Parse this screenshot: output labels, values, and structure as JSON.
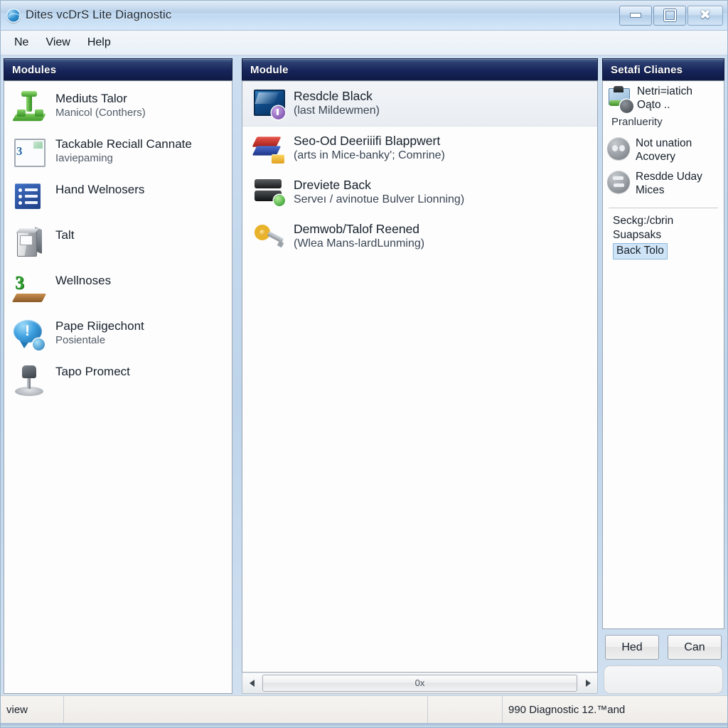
{
  "window": {
    "title": "Dites vcDrS Lite Diagnostic",
    "app_icon": "globe-icon",
    "controls": {
      "minimize": "minimize-icon",
      "maximize": "maximize-icon",
      "close": "close-icon"
    }
  },
  "menubar": {
    "items": [
      "Ne",
      "View",
      "Help"
    ]
  },
  "panels": {
    "left": {
      "header": "Modules",
      "items": [
        {
          "icon": "green-plug-icon",
          "title": "Mediuts Talor",
          "subtitle": "Manicol (Conthers)"
        },
        {
          "icon": "framed-photo-icon",
          "title": "Tackable Reciall Cannate",
          "subtitle": "Iaviepaming"
        },
        {
          "icon": "blue-list-icon",
          "title": "Hand Welnosers",
          "subtitle": ""
        },
        {
          "icon": "pc-tower-icon",
          "title": "Talt",
          "subtitle": ""
        },
        {
          "icon": "wood-board-icon",
          "title": "Wellnoses",
          "subtitle": ""
        },
        {
          "icon": "blue-bubble-icon",
          "title": "Pape Riigechont",
          "subtitle": "Posientale"
        },
        {
          "icon": "microphone-icon",
          "title": "Tapo Promect",
          "subtitle": ""
        }
      ]
    },
    "middle": {
      "header": "Module",
      "items": [
        {
          "icon": "blue-screen-icon",
          "title": "Resdcle Black",
          "subtitle": "(last Mildewmen)",
          "selected": true
        },
        {
          "icon": "red-boxes-icon",
          "title": "Seo-Od Deeriiifi Blappwert",
          "subtitle": "(arts in Mice-banky'; Comrine)",
          "selected": false
        },
        {
          "icon": "black-server-icon",
          "title": "Dreviete Back",
          "subtitle": "Serveı / avinotue Bulver Lionning)",
          "selected": false
        },
        {
          "icon": "gold-key-icon",
          "title": "Demwob/Talof Reened",
          "subtitle": "(Wlea Mans-lardLunming)",
          "selected": false
        }
      ],
      "scrollbar": {
        "left_arrow": "triangle-left-icon",
        "right_arrow": "triangle-right-icon",
        "thumb_label": "0x"
      }
    },
    "right": {
      "header": "Setafi Clianes",
      "rows": [
        {
          "icon": "camera-tool-icon",
          "title": "Netri=iatich",
          "line2": "Oąto ..",
          "sub": "Pranluerity"
        },
        {
          "icon": "gray-round-icon",
          "title": "Not unation",
          "line2": "Acovery",
          "sub": ""
        },
        {
          "icon": "gray-round-alt-icon",
          "title": "Resdde Uday",
          "line2": "Mices",
          "sub": ""
        }
      ],
      "links": [
        {
          "label": "Seckg:/cbrin",
          "selected": false
        },
        {
          "label": "Suapsaks",
          "selected": false
        },
        {
          "label": "Back Tolo",
          "selected": true
        }
      ],
      "buttons": [
        "Hed",
        "Can"
      ]
    }
  },
  "statusbar": {
    "left": "view",
    "middle": "",
    "third": "",
    "right": "990 Diagnostic 12.™and"
  },
  "colors": {
    "panel_header_start": "#4a6392",
    "panel_header_end": "#101a44",
    "selection_blue": "#cfe4f7",
    "window_chrome": "#bed4ea"
  }
}
